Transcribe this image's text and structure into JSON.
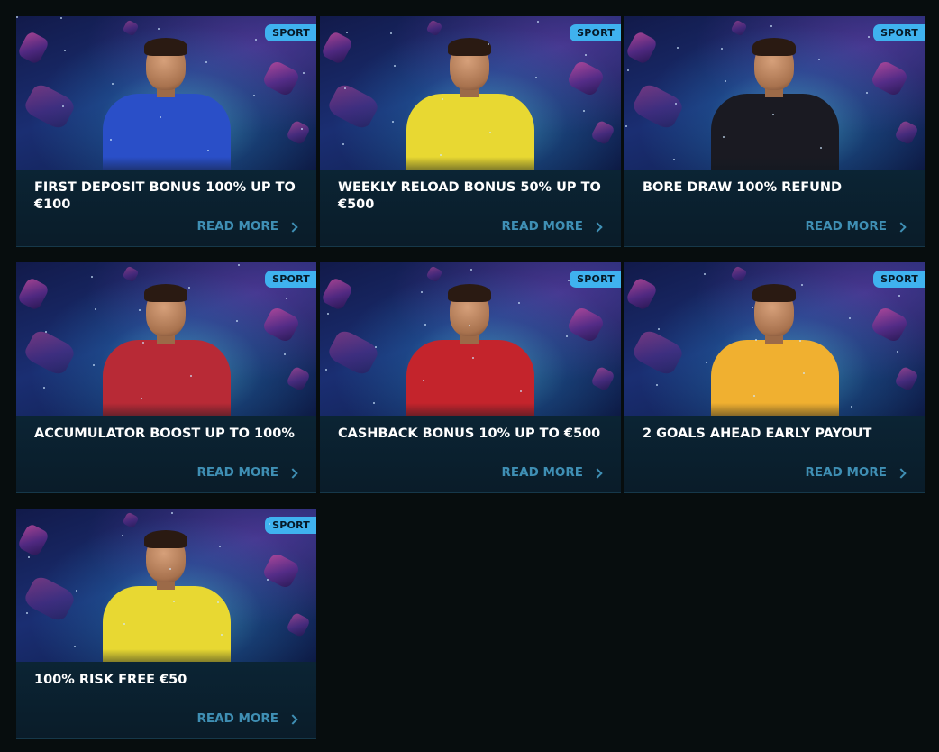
{
  "colors": {
    "background": "#070d0e",
    "card": "#0b2233",
    "badge": "#3fb2ef",
    "read_more": "#3f8fb4"
  },
  "promotions": [
    {
      "badge": "SPORT",
      "title": "FIRST DEPOSIT BONUS 100% UP TO €100",
      "link": "READ MORE",
      "jersey": "#2a4fc8"
    },
    {
      "badge": "SPORT",
      "title": "WEEKLY RELOAD BONUS 50% UP TO €500",
      "link": "READ MORE",
      "jersey": "#e8d832"
    },
    {
      "badge": "SPORT",
      "title": "BORE DRAW 100% REFUND",
      "link": "READ MORE",
      "jersey": "#1a1a22"
    },
    {
      "badge": "SPORT",
      "title": "ACCUMULATOR BOOST UP TO 100%",
      "link": "READ MORE",
      "jersey": "#b82a36"
    },
    {
      "badge": "SPORT",
      "title": "CASHBACK BONUS 10% UP TO €500",
      "link": "READ MORE",
      "jersey": "#c4242c"
    },
    {
      "badge": "SPORT",
      "title": "2 GOALS AHEAD EARLY PAYOUT",
      "link": "READ MORE",
      "jersey": "#f0b030"
    },
    {
      "badge": "SPORT",
      "title": "100% RISK FREE €50",
      "link": "READ MORE",
      "jersey": "#e8d832"
    }
  ]
}
